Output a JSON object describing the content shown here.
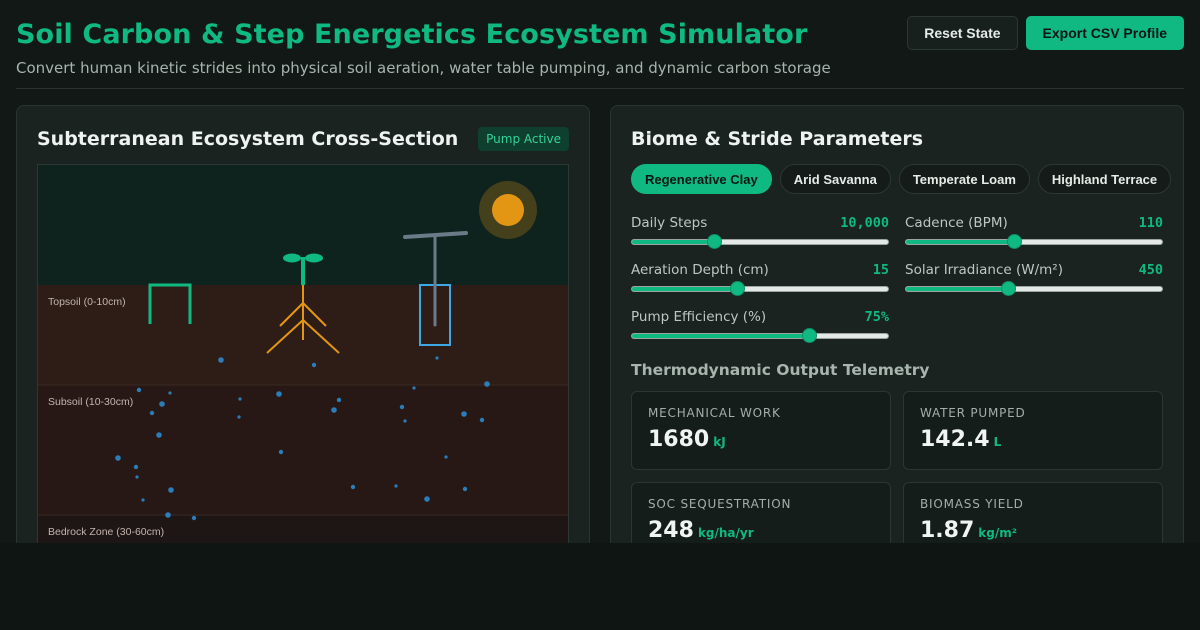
{
  "app": {
    "title": "Soil Carbon & Step Energetics Ecosystem Simulator",
    "subtitle": "Convert human kinetic strides into physical soil aeration, water table pumping, and dynamic carbon storage",
    "reset_label": "Reset State",
    "export_label": "Export CSV Profile"
  },
  "cross_section": {
    "title": "Subterranean Ecosystem Cross-Section",
    "status": "Pump Active",
    "layers": [
      {
        "label": "Topsoil (0-10cm)",
        "color": "#2e1d17"
      },
      {
        "label": "Subsoil (10-30cm)",
        "color": "#271816"
      },
      {
        "label": "Bedrock Zone (30-60cm)",
        "color": "#1e1614"
      }
    ],
    "sky_color": "#0f231e",
    "sun_color": "#e29614",
    "plant_color": "#10b981",
    "root_color": "#e29614",
    "water_color": "#2b8fd6",
    "pump_color": "#3ea8e6",
    "pump_shaft_color": "#6b7a88"
  },
  "parameters": {
    "title": "Biome & Stride Parameters",
    "biomes": [
      {
        "label": "Regenerative Clay",
        "active": true
      },
      {
        "label": "Arid Savanna",
        "active": false
      },
      {
        "label": "Temperate Loam",
        "active": false
      },
      {
        "label": "Highland Terrace",
        "active": false
      }
    ],
    "sliders": [
      {
        "label": "Daily Steps",
        "value_text": "10,000",
        "fraction": 0.32
      },
      {
        "label": "Cadence (BPM)",
        "value_text": "110",
        "fraction": 0.42
      },
      {
        "label": "Aeration Depth (cm)",
        "value_text": "15",
        "fraction": 0.41
      },
      {
        "label": "Solar Irradiance (W/m²)",
        "value_text": "450",
        "fraction": 0.4
      },
      {
        "label": "Pump Efficiency (%)",
        "value_text": "75%",
        "fraction": 0.69
      }
    ]
  },
  "telemetry": {
    "heading": "Thermodynamic Output Telemetry",
    "metrics": [
      {
        "label": "MECHANICAL WORK",
        "value": "1680",
        "unit": "kJ"
      },
      {
        "label": "WATER PUMPED",
        "value": "142.4",
        "unit": "L"
      },
      {
        "label": "SOC SEQUESTRATION",
        "value": "248",
        "unit": "kg/ha/yr"
      },
      {
        "label": "BIOMASS YIELD",
        "value": "1.87",
        "unit": "kg/m²"
      }
    ]
  },
  "theme": {
    "accent": "#10b981",
    "background": "#111815",
    "panel": "#1a2320"
  }
}
